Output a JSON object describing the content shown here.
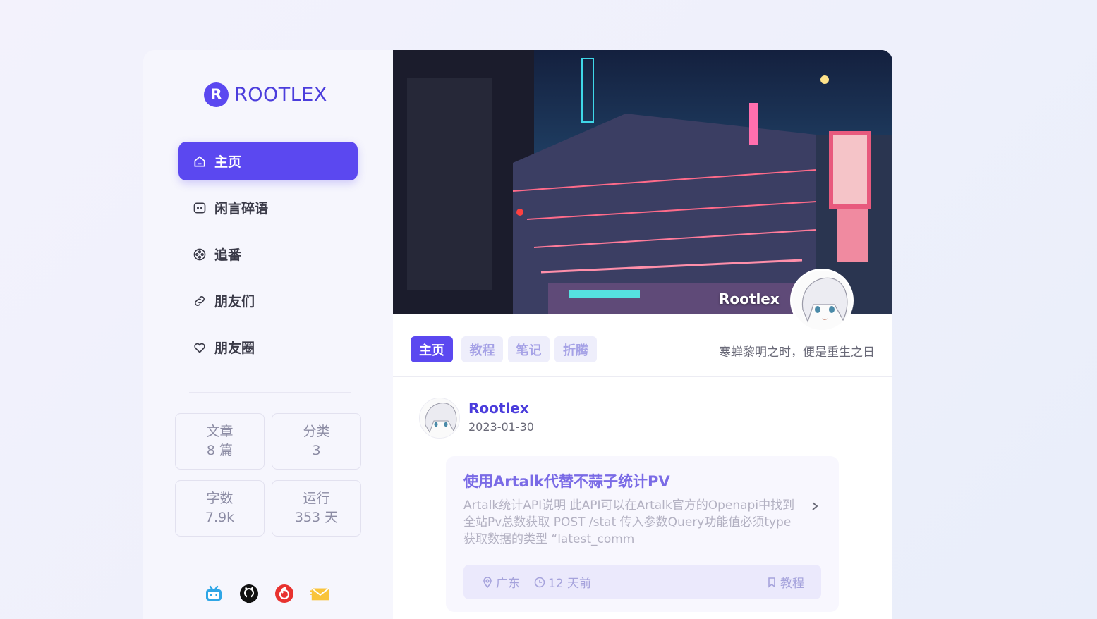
{
  "brand": {
    "mark": "R",
    "name": "ROOTLEX",
    "accent": "#5b48f0"
  },
  "nav": [
    {
      "label": "主页",
      "icon": "home-icon",
      "active": true
    },
    {
      "label": "闲言碎语",
      "icon": "chat-icon",
      "active": false
    },
    {
      "label": "追番",
      "icon": "film-reel-icon",
      "active": false
    },
    {
      "label": "朋友们",
      "icon": "link-icon",
      "active": false
    },
    {
      "label": "朋友圈",
      "icon": "heart-icon",
      "active": false
    }
  ],
  "stats": [
    {
      "label": "文章",
      "value": "8 篇"
    },
    {
      "label": "分类",
      "value": "3"
    },
    {
      "label": "字数",
      "value": "7.9k"
    },
    {
      "label": "运行",
      "value": "353 天"
    }
  ],
  "socials": [
    "bilibili-icon",
    "github-icon",
    "netease-music-icon",
    "mail-icon"
  ],
  "banner": {
    "name": "Rootlex"
  },
  "tabs": [
    {
      "label": "主页",
      "active": true
    },
    {
      "label": "教程",
      "active": false
    },
    {
      "label": "笔记",
      "active": false
    },
    {
      "label": "折腾",
      "active": false
    }
  ],
  "motto": "寒蝉黎明之时，便是重生之日",
  "post": {
    "author": "Rootlex",
    "date": "2023-01-30",
    "title": "使用Artalk代替不蒜子统计PV",
    "excerpt": "Artalk统计API说明 此API可以在Artalk官方的Openapi中找到 全站Pv总数获取 POST /stat 传入参数Query功能值必须type 获取数据的类型 “latest_comm",
    "location": "广东",
    "time_ago": "12 天前",
    "category": "教程"
  }
}
